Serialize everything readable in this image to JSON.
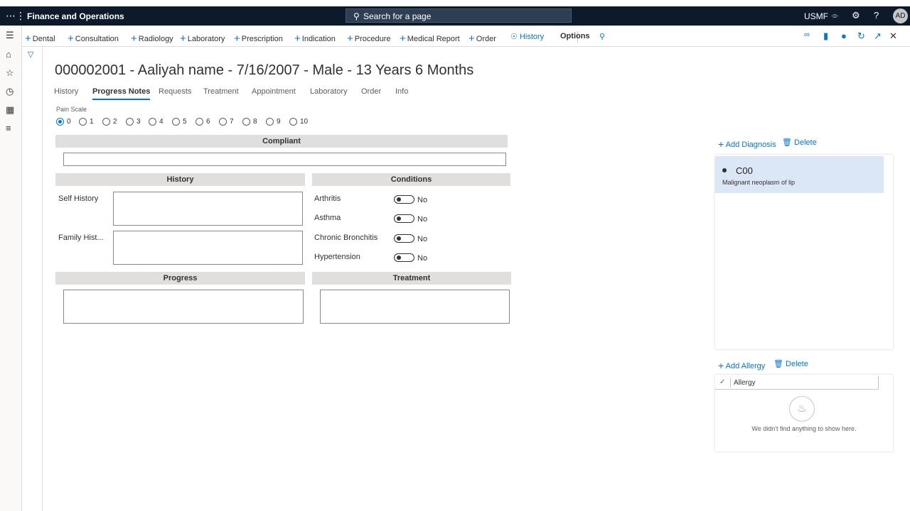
{
  "topbar": {
    "app_title": "Finance and Operations",
    "search_placeholder": "Search for a page",
    "company": "USMF",
    "avatar_initials": "AD",
    "icons": [
      "waffle-icon",
      "bell-icon",
      "gear-icon",
      "help-icon"
    ]
  },
  "actions": {
    "items": [
      "Dental",
      "Consultation",
      "Radiology",
      "Laboratory",
      "Prescription",
      "Indication",
      "Procedure",
      "Medical Report",
      "Order"
    ],
    "history": "History",
    "options": "Options"
  },
  "header": {
    "title": "000002001 - Aaliyah name - 7/16/2007 - Male - 13 Years 6 Months"
  },
  "tabs": [
    "History",
    "Progress Notes",
    "Requests",
    "Treatment",
    "Appointment",
    "Laboratory",
    "Order",
    "Info"
  ],
  "active_tab": "Progress Notes",
  "pain_scale": {
    "label": "Pain Scale",
    "options": [
      "0",
      "1",
      "2",
      "3",
      "4",
      "5",
      "6",
      "7",
      "8",
      "9",
      "10"
    ],
    "selected": "0"
  },
  "sections": {
    "compliant": "Compliant",
    "history": "History",
    "conditions": "Conditions",
    "progress": "Progress",
    "treatment": "Treatment"
  },
  "history_fields": {
    "self_history": "Self History",
    "family_history": "Family Hist..."
  },
  "conditions": [
    {
      "label": "Arthritis",
      "value": "No"
    },
    {
      "label": "Asthma",
      "value": "No"
    },
    {
      "label": "Chronic Bronchitis",
      "value": "No"
    },
    {
      "label": "Hypertension",
      "value": "No"
    }
  ],
  "diagnosis": {
    "add_label": "Add Diagnosis",
    "delete_label": "Delete",
    "items": [
      {
        "code": "C00",
        "description": "Malignant neoplasm of lip"
      }
    ]
  },
  "allergy": {
    "add_label": "Add Allergy",
    "delete_label": "Delete",
    "column": "Allergy",
    "empty_text": "We didn't find anything to show here."
  }
}
